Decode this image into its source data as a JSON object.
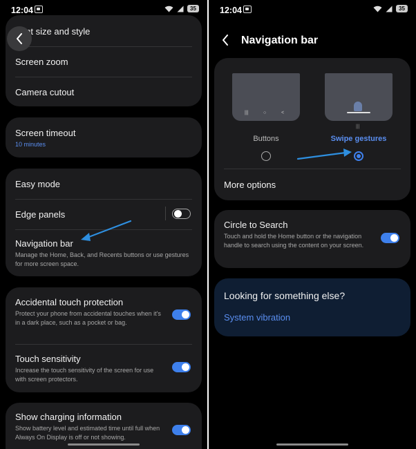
{
  "status": {
    "time": "12:04",
    "battery": "35",
    "battery_right": "35"
  },
  "left": {
    "card1": {
      "item1": "Font size and style",
      "item2": "Screen zoom",
      "item3": "Camera cutout"
    },
    "card2": {
      "title": "Screen timeout",
      "value": "10 minutes"
    },
    "card3": {
      "easy_mode": "Easy mode",
      "edge_panels": "Edge panels",
      "nav_bar_title": "Navigation bar",
      "nav_bar_desc": "Manage the Home, Back, and Recents buttons or use gestures for more screen space."
    },
    "card4": {
      "accidental_title": "Accidental touch protection",
      "accidental_desc": "Protect your phone from accidental touches when it's in a dark place, such as a pocket or bag.",
      "touch_title": "Touch sensitivity",
      "touch_desc": "Increase the touch sensitivity of the screen for use with screen protectors."
    },
    "card5": {
      "charging_title": "Show charging information",
      "charging_desc": "Show battery level and estimated time until full when Always On Display is off or not showing."
    },
    "toggles": {
      "edge_panels": false,
      "accidental": true,
      "touch": true,
      "charging": true
    }
  },
  "right": {
    "header": {
      "title": "Navigation bar"
    },
    "options": {
      "buttons_label": "Buttons",
      "gestures_label": "Swipe gestures",
      "selected": "Swipe gestures"
    },
    "more_options": "More options",
    "circle": {
      "title": "Circle to Search",
      "desc": "Touch and hold the Home button or the navigation handle to search using the content on your screen.",
      "on": true
    },
    "looking": {
      "title": "Looking for something else?",
      "link": "System vibration"
    }
  },
  "colors": {
    "accent": "#3e80ec",
    "card": "#1c1c1e",
    "link": "#5a8ef0",
    "annotation_arrow": "#2e8fe0"
  }
}
